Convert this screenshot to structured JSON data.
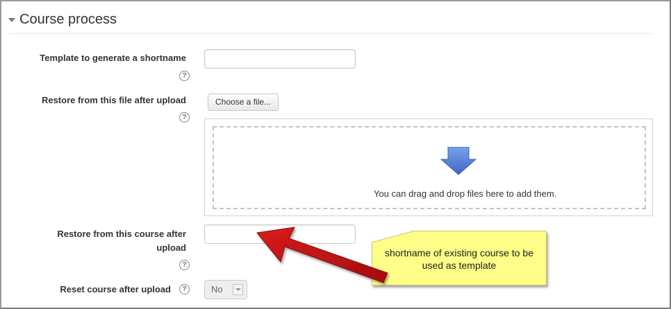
{
  "section": {
    "title": "Course process"
  },
  "fields": {
    "template_shortname": {
      "label": "Template to generate a shortname",
      "value": ""
    },
    "restore_file": {
      "label": "Restore from this file after upload",
      "button_label": "Choose a file...",
      "drop_message": "You can drag and drop files here to add them."
    },
    "restore_course": {
      "label_line1": "Restore from this course after",
      "label_line2": "upload",
      "value": ""
    },
    "reset_course": {
      "label": "Reset course after upload",
      "selected": "No"
    }
  },
  "help_icon": "question-mark-icon",
  "annotation": {
    "line1": "shortname of existing course to be",
    "line2": "used as template",
    "note_color": "#fdfd87",
    "arrow_color": "#c41212"
  },
  "colors": {
    "drop_arrow": "#5b82d6"
  }
}
